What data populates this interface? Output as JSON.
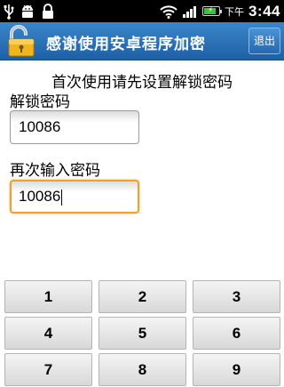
{
  "statusbar": {
    "ampm": "下午",
    "time": "3:44",
    "icons": [
      "usb-icon",
      "android-debug-icon",
      "lock-notification-icon",
      "wifi-icon",
      "signal-icon",
      "battery-icon"
    ]
  },
  "titlebar": {
    "title": "感谢使用安卓程序加密",
    "exit_label": "退出",
    "icon": "unlock-icon"
  },
  "form": {
    "hint": "首次使用请先设置解锁密码",
    "password_label": "解锁密码",
    "password_value": "10086",
    "confirm_label": "再次输入密码",
    "confirm_value": "10086"
  },
  "keypad": {
    "keys": [
      "1",
      "2",
      "3",
      "4",
      "5",
      "6",
      "7",
      "8",
      "9"
    ]
  },
  "colors": {
    "titlebar": "#2a72bb",
    "focus_border": "#f0a030"
  }
}
